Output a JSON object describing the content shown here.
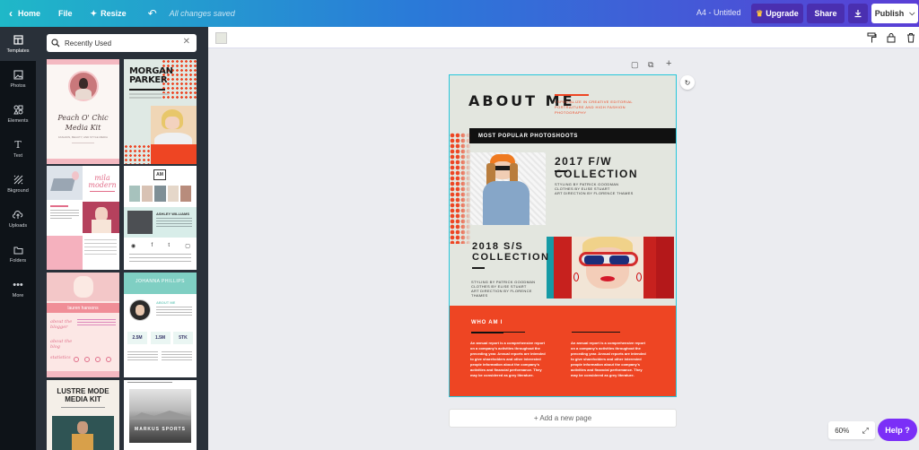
{
  "topbar": {
    "home": "Home",
    "file": "File",
    "resize": "Resize",
    "saved": "All changes saved",
    "doc_title": "A4 - Untitled",
    "upgrade": "Upgrade",
    "share": "Share",
    "publish": "Publish"
  },
  "rail": [
    "Templates",
    "Photos",
    "Elements",
    "Text",
    "Bkground",
    "Uploads",
    "Folders",
    "More"
  ],
  "search": {
    "value": "Recently Used"
  },
  "templates": {
    "t1": {
      "title": "Peach O' Chic",
      "subtitle": "Media Kit",
      "tag": "FASHION, BEAUTY, AND STYLE MEDIA"
    },
    "t2": {
      "name": "MORGAN PARKER"
    },
    "t3": {
      "name": "mila modern"
    },
    "t4": {
      "logo": "AM",
      "name": "ASHLEY WILLIAMS"
    },
    "t5": {
      "name": "lauren hansons",
      "about": "about the blogger",
      "about2": "about the blog",
      "stats": "statistics"
    },
    "t6": {
      "name": "JOHANNA PHILLIPS",
      "about": "ABOUT ME",
      "s1": "2.5M",
      "s2": "1.5M",
      "s3": "5TK"
    },
    "t7": {
      "title": "LUSTRE MODE MEDIA KIT"
    },
    "t8": {
      "name": "MARKUS SPORTS"
    }
  },
  "page": {
    "about_title": "ABOUT ME",
    "intro": "I SPECIALIZE IN CREATIVE EDITORIAL PORTRAITURE AND HIGH FASHION PHOTOGRAPHY",
    "popular": "MOST POPULAR PHOTOSHOOTS",
    "c1_title": "2017 F/W COLLECTION",
    "c1_lines": [
      "STYLING BY PATRICK GOODMAN",
      "CLOTHES BY ELISE STUART",
      "ART DIRECTION BY FLORENCE THAMES"
    ],
    "c2_title": [
      "2018 S/S",
      "COLLECTION"
    ],
    "c2_lines": [
      "STYLING BY PATRICK GOODMAN",
      "CLOTHES BY ELISE STUART",
      "ART DIRECTION BY FLORENCE",
      "THAMES"
    ],
    "who": "WHO AM I",
    "para": [
      "An annual report is a comprehensive report",
      "on a company's activities throughout the",
      "preceding year. Annual reports are intended",
      "to give shareholders and other interested",
      "people information about the company's",
      "activities and financial performance. They",
      "may be considered as grey literature."
    ]
  },
  "add_page": "+ Add a new page",
  "zoom": "60%",
  "help": "Help ?",
  "colors": {
    "accent_red": "#ee4523",
    "page_bg": "#e3e6df",
    "teal": "#26c6da",
    "purple": "#7b2ff7"
  }
}
